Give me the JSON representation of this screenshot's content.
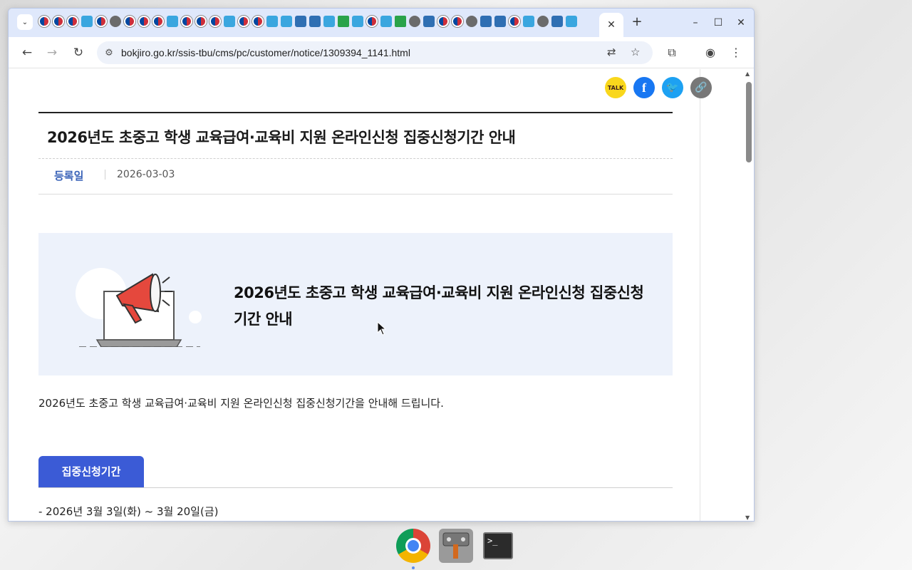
{
  "browser": {
    "url": "bokjiro.go.kr/ssis-tbu/cms/pc/customer/notice/1309394_1141.html",
    "tab_close": "✕",
    "new_tab": "+",
    "minimize": "–",
    "maximize": "☐",
    "close": "✕",
    "back": "←",
    "forward": "→",
    "reload": "↻"
  },
  "share": {
    "kakao_label": "TALK",
    "facebook_label": "f",
    "twitter_label": "🐦",
    "link_label": "🔗"
  },
  "notice": {
    "title": "2026년도 초중고 학생 교육급여·교육비 지원 온라인신청 집중신청기간 안내",
    "meta_label": "등록일",
    "meta_value": "2026-03-03",
    "banner_text": "2026년도 초중고 학생 교육급여·교육비 지원 온라인신청 집중신청기간 안내",
    "description": "2026년도 초중고 학생 교육급여·교육비 지원 온라인신청 집중신청기간을 안내해 드립니다.",
    "section_tab": "집중신청기간",
    "period": "- 2026년 3월 3일(화) ~ 3월 20일(금)"
  },
  "taskbar": {
    "terminal_label": ">_"
  },
  "colors": {
    "accent": "#3b5bd6",
    "meta_label": "#3a63b8",
    "banner_bg": "#edf2fb",
    "tabstrip": "#dfe8fb"
  }
}
